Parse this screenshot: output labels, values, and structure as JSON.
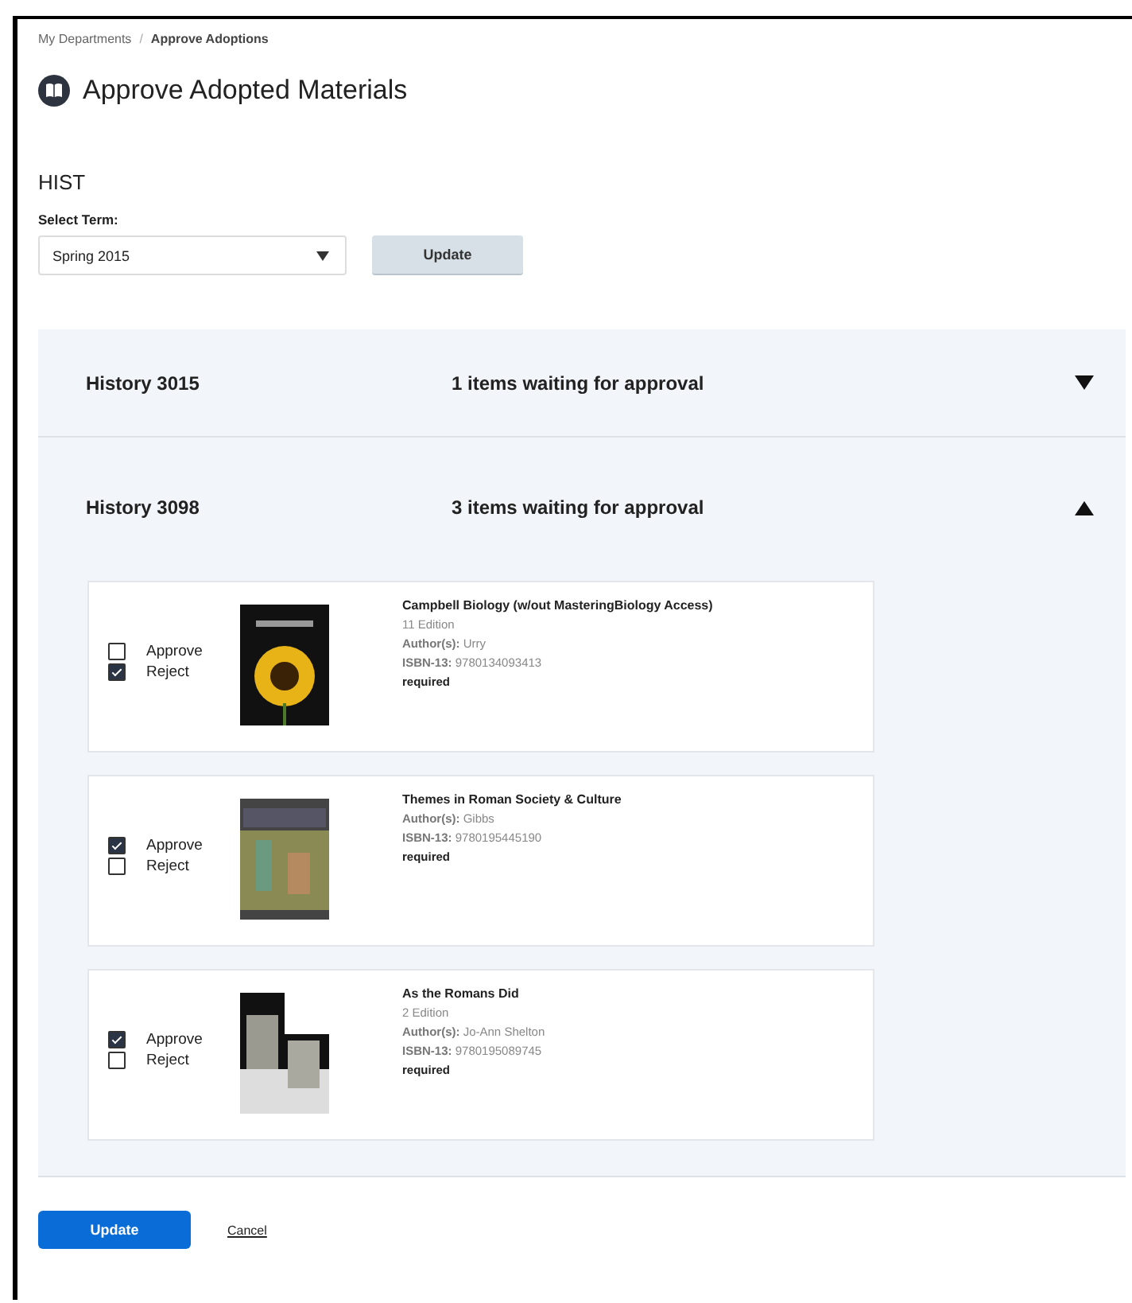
{
  "breadcrumb": [
    {
      "label": "My Departments",
      "current": false
    },
    {
      "label": "Approve Adoptions",
      "current": true
    }
  ],
  "breadcrumb_separator": "/",
  "page_title": "Approve Adopted Materials",
  "department": "HIST",
  "term_select": {
    "label": "Select Term:",
    "value": "Spring 2015",
    "button": "Update"
  },
  "courses": [
    {
      "name": "History 3015",
      "status": "1 items waiting for approval",
      "expanded": false
    },
    {
      "name": "History 3098",
      "status": "3 items waiting for approval",
      "expanded": true,
      "items": [
        {
          "approve_label": "Approve",
          "reject_label": "Reject",
          "approve": false,
          "reject": true,
          "kind": "sunflower",
          "title": "Campbell Biology (w/out MasteringBiology Access)",
          "edition": "11 Edition",
          "author_label": "Author(s):",
          "author": "Urry",
          "isbn_label": "ISBN-13:",
          "isbn": "9780134093413",
          "requirement": "required"
        },
        {
          "approve_label": "Approve",
          "reject_label": "Reject",
          "approve": true,
          "reject": false,
          "kind": "painting",
          "title": "Themes in Roman Society & Culture",
          "author_label": "Author(s):",
          "author": "Gibbs",
          "isbn_label": "ISBN-13:",
          "isbn": "9780195445190",
          "requirement": "required"
        },
        {
          "approve_label": "Approve",
          "reject_label": "Reject",
          "approve": true,
          "reject": false,
          "kind": "reliefs",
          "title": "As the Romans Did",
          "edition": "2 Edition",
          "author_label": "Author(s):",
          "author": "Jo-Ann Shelton",
          "isbn_label": "ISBN-13:",
          "isbn": "9780195089745",
          "requirement": "required"
        }
      ]
    }
  ],
  "footer": {
    "submit": "Update",
    "cancel": "Cancel"
  }
}
